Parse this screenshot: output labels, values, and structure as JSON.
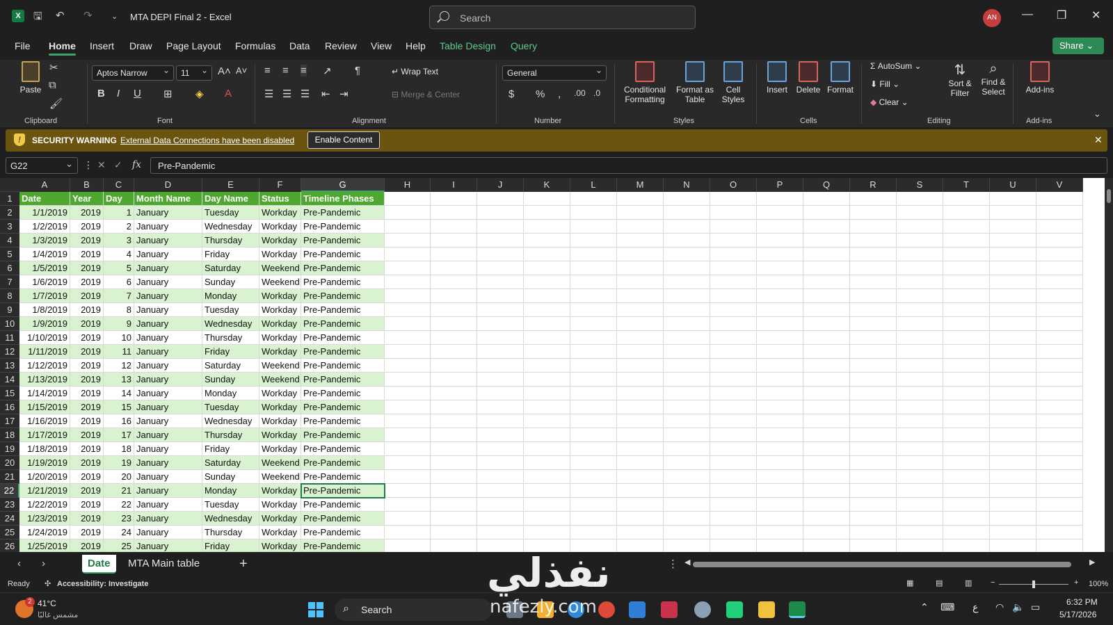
{
  "title_bar": {
    "doc_title": "MTA DEPI Final 2  -  Excel",
    "search_placeholder": "Search",
    "avatar_initials": "AN"
  },
  "menu": [
    "File",
    "Home",
    "Insert",
    "Draw",
    "Page Layout",
    "Formulas",
    "Data",
    "Review",
    "View",
    "Help",
    "Table Design",
    "Query"
  ],
  "share_label": "Share",
  "ribbon": {
    "clipboard": {
      "paste": "Paste",
      "label": "Clipboard"
    },
    "font": {
      "name": "Aptos Narrow",
      "size": "11",
      "label": "Font"
    },
    "alignment": {
      "wrap_text": "Wrap Text",
      "merge_center": "Merge & Center",
      "label": "Alignment"
    },
    "number": {
      "format": "General",
      "label": "Number"
    },
    "styles": {
      "conditional": "Conditional",
      "conditional2": "Formatting",
      "format_as": "Format as",
      "format_as2": "Table",
      "cell": "Cell",
      "cell2": "Styles",
      "label": "Styles"
    },
    "cells": {
      "insert": "Insert",
      "delete": "Delete",
      "format": "Format",
      "label": "Cells"
    },
    "editing": {
      "autosum": "AutoSum",
      "fill": "Fill",
      "clear": "Clear",
      "sort": "Sort &",
      "sort2": "Filter",
      "find": "Find &",
      "find2": "Select",
      "label": "Editing"
    },
    "addins": {
      "addins": "Add-ins",
      "label": "Add-ins"
    }
  },
  "security": {
    "title": "SECURITY WARNING",
    "message": "External Data Connections have been disabled",
    "button": "Enable Content"
  },
  "formula_bar": {
    "name_box": "G22",
    "fx": "fx",
    "value": "Pre-Pandemic"
  },
  "columns": [
    "A",
    "B",
    "C",
    "D",
    "E",
    "F",
    "G",
    "H",
    "I",
    "J",
    "K",
    "L",
    "M",
    "N",
    "O",
    "P",
    "Q",
    "R",
    "S",
    "T",
    "U",
    "V"
  ],
  "table": {
    "headers": [
      "Date",
      "Year",
      "Day",
      "Month Name",
      "Day Name",
      "Status",
      "Timeline Phases"
    ],
    "rows": [
      [
        "1/1/2019",
        "2019",
        "1",
        "January",
        "Tuesday",
        "Workday",
        "Pre-Pandemic"
      ],
      [
        "1/2/2019",
        "2019",
        "2",
        "January",
        "Wednesday",
        "Workday",
        "Pre-Pandemic"
      ],
      [
        "1/3/2019",
        "2019",
        "3",
        "January",
        "Thursday",
        "Workday",
        "Pre-Pandemic"
      ],
      [
        "1/4/2019",
        "2019",
        "4",
        "January",
        "Friday",
        "Workday",
        "Pre-Pandemic"
      ],
      [
        "1/5/2019",
        "2019",
        "5",
        "January",
        "Saturday",
        "Weekend",
        "Pre-Pandemic"
      ],
      [
        "1/6/2019",
        "2019",
        "6",
        "January",
        "Sunday",
        "Weekend",
        "Pre-Pandemic"
      ],
      [
        "1/7/2019",
        "2019",
        "7",
        "January",
        "Monday",
        "Workday",
        "Pre-Pandemic"
      ],
      [
        "1/8/2019",
        "2019",
        "8",
        "January",
        "Tuesday",
        "Workday",
        "Pre-Pandemic"
      ],
      [
        "1/9/2019",
        "2019",
        "9",
        "January",
        "Wednesday",
        "Workday",
        "Pre-Pandemic"
      ],
      [
        "1/10/2019",
        "2019",
        "10",
        "January",
        "Thursday",
        "Workday",
        "Pre-Pandemic"
      ],
      [
        "1/11/2019",
        "2019",
        "11",
        "January",
        "Friday",
        "Workday",
        "Pre-Pandemic"
      ],
      [
        "1/12/2019",
        "2019",
        "12",
        "January",
        "Saturday",
        "Weekend",
        "Pre-Pandemic"
      ],
      [
        "1/13/2019",
        "2019",
        "13",
        "January",
        "Sunday",
        "Weekend",
        "Pre-Pandemic"
      ],
      [
        "1/14/2019",
        "2019",
        "14",
        "January",
        "Monday",
        "Workday",
        "Pre-Pandemic"
      ],
      [
        "1/15/2019",
        "2019",
        "15",
        "January",
        "Tuesday",
        "Workday",
        "Pre-Pandemic"
      ],
      [
        "1/16/2019",
        "2019",
        "16",
        "January",
        "Wednesday",
        "Workday",
        "Pre-Pandemic"
      ],
      [
        "1/17/2019",
        "2019",
        "17",
        "January",
        "Thursday",
        "Workday",
        "Pre-Pandemic"
      ],
      [
        "1/18/2019",
        "2019",
        "18",
        "January",
        "Friday",
        "Workday",
        "Pre-Pandemic"
      ],
      [
        "1/19/2019",
        "2019",
        "19",
        "January",
        "Saturday",
        "Weekend",
        "Pre-Pandemic"
      ],
      [
        "1/20/2019",
        "2019",
        "20",
        "January",
        "Sunday",
        "Weekend",
        "Pre-Pandemic"
      ],
      [
        "1/21/2019",
        "2019",
        "21",
        "January",
        "Monday",
        "Workday",
        "Pre-Pandemic"
      ],
      [
        "1/22/2019",
        "2019",
        "22",
        "January",
        "Tuesday",
        "Workday",
        "Pre-Pandemic"
      ],
      [
        "1/23/2019",
        "2019",
        "23",
        "January",
        "Wednesday",
        "Workday",
        "Pre-Pandemic"
      ],
      [
        "1/24/2019",
        "2019",
        "24",
        "January",
        "Thursday",
        "Workday",
        "Pre-Pandemic"
      ],
      [
        "1/25/2019",
        "2019",
        "25",
        "January",
        "Friday",
        "Workday",
        "Pre-Pandemic"
      ]
    ]
  },
  "active_cell": "G22",
  "sheets": [
    "Date",
    "MTA Main table"
  ],
  "status": {
    "ready": "Ready",
    "accessibility": "Accessibility: Investigate",
    "zoom": "100%"
  },
  "taskbar": {
    "weather_temp": "41°C",
    "weather_desc": "مشمس غالبًا",
    "weather_badge": "2",
    "search": "Search",
    "lang": "ع",
    "time": "6:32 PM",
    "date": "5/17/2026"
  },
  "watermark": {
    "arabic": "نفذلي",
    "latin": "nafezly.com"
  },
  "colors": {
    "accent": "#3fa36d",
    "header_green": "#4ea72e",
    "band_green": "#d9f2d0",
    "warning_bg": "#6b5310"
  }
}
